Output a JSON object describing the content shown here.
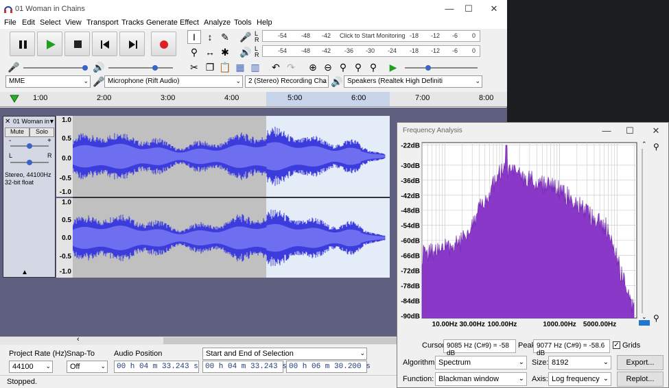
{
  "window": {
    "title": "01 Woman in Chains"
  },
  "menu": [
    "File",
    "Edit",
    "Select",
    "View",
    "Transport",
    "Tracks",
    "Generate",
    "Effect",
    "Analyze",
    "Tools",
    "Help"
  ],
  "meters": {
    "record": [
      "-54",
      "-48",
      "-42",
      "Click to Start Monitoring",
      "-18",
      "-12",
      "-6",
      "0"
    ],
    "play": [
      "-54",
      "-48",
      "-42",
      "-36",
      "-30",
      "-24",
      "-18",
      "-12",
      "-6",
      "0"
    ]
  },
  "devices": {
    "host": "MME",
    "mic": "Microphone (Rift Audio)",
    "channels": "2 (Stereo) Recording Cha",
    "speakers": "Speakers (Realtek High Definiti"
  },
  "ruler": [
    "1:00",
    "2:00",
    "3:00",
    "4:00",
    "5:00",
    "6:00",
    "7:00",
    "8:00"
  ],
  "track": {
    "name": "01 Woman in",
    "mute": "Mute",
    "solo": "Solo",
    "info1": "Stereo, 44100Hz",
    "info2": "32-bit float",
    "pan_l": "L",
    "pan_r": "R",
    "gain_minus": "-",
    "gain_plus": "+"
  },
  "scale": [
    "1.0",
    "0.5",
    "0.0",
    "-0.5",
    "-1.0"
  ],
  "bottom": {
    "rate_label": "Project Rate (Hz)",
    "rate_value": "44100",
    "snap_label": "Snap-To",
    "snap_value": "Off",
    "pos_label": "Audio Position",
    "pos_value": "00 h 04 m 33.243 s",
    "sel_label": "Start and End of Selection",
    "sel_start": "00 h 04 m 33.243 s",
    "sel_end": "00 h 06 m 30.200 s",
    "status": "Stopped."
  },
  "freq": {
    "title": "Frequency Analysis",
    "db_labels": [
      "-22dB",
      "-30dB",
      "-36dB",
      "-42dB",
      "-48dB",
      "-54dB",
      "-60dB",
      "-66dB",
      "-72dB",
      "-78dB",
      "-84dB",
      "-90dB"
    ],
    "hz_labels": [
      "10.00Hz",
      "30.00Hz",
      "100.00Hz",
      "1000.00Hz",
      "5000.00Hz"
    ],
    "cursor_label": "Cursor:",
    "cursor_value": "9085 Hz (C#9) = -58 dB",
    "peak_label": "Peak:",
    "peak_value": "9077 Hz (C#9) = -58.6 dB",
    "grids": "Grids",
    "algorithm_label": "Algorithm:",
    "algorithm": "Spectrum",
    "size_label": "Size:",
    "size": "8192",
    "function_label": "Function:",
    "function": "Blackman window",
    "axis_label": "Axis:",
    "axis": "Log frequency",
    "export": "Export...",
    "replot": "Replot..."
  }
}
